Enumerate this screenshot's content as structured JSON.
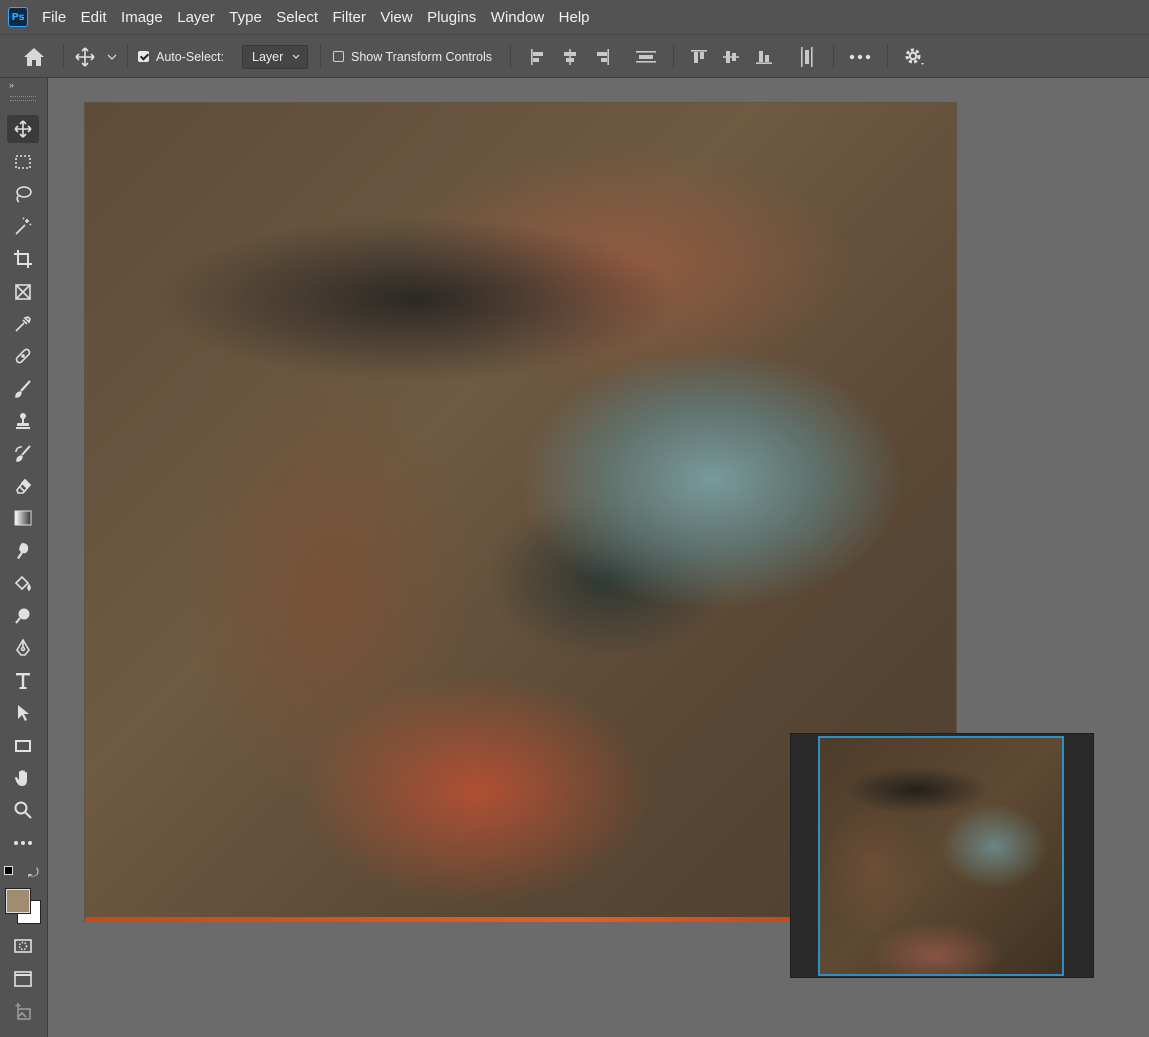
{
  "app": {
    "logo_text": "Ps"
  },
  "menu": [
    "File",
    "Edit",
    "Image",
    "Layer",
    "Type",
    "Select",
    "Filter",
    "View",
    "Plugins",
    "Window",
    "Help"
  ],
  "options": {
    "auto_select_label": "Auto-Select:",
    "auto_select_checked": true,
    "auto_select_target": "Layer",
    "show_transform_label": "Show Transform Controls",
    "show_transform_checked": false
  },
  "toolbar": {
    "tools": [
      {
        "name": "move-tool",
        "icon": "move-icon",
        "active": true
      },
      {
        "name": "rectangular-marquee-tool",
        "icon": "marquee-icon"
      },
      {
        "name": "lasso-tool",
        "icon": "lasso-icon"
      },
      {
        "name": "magic-wand-tool",
        "icon": "magic-wand-icon"
      },
      {
        "name": "crop-tool",
        "icon": "crop-icon"
      },
      {
        "name": "frame-tool",
        "icon": "frame-icon"
      },
      {
        "name": "eyedropper-tool",
        "icon": "eyedropper-icon"
      },
      {
        "name": "healing-brush-tool",
        "icon": "bandage-icon"
      },
      {
        "name": "brush-tool",
        "icon": "brush-icon"
      },
      {
        "name": "clone-stamp-tool",
        "icon": "stamp-icon"
      },
      {
        "name": "history-brush-tool",
        "icon": "history-brush-icon"
      },
      {
        "name": "eraser-tool",
        "icon": "eraser-icon"
      },
      {
        "name": "gradient-tool",
        "icon": "gradient-icon"
      },
      {
        "name": "smudge-tool",
        "icon": "smudge-icon"
      },
      {
        "name": "paint-bucket-tool",
        "icon": "bucket-icon"
      },
      {
        "name": "dodge-tool",
        "icon": "dodge-icon"
      },
      {
        "name": "pen-tool",
        "icon": "pen-icon"
      },
      {
        "name": "type-tool",
        "icon": "type-icon"
      },
      {
        "name": "path-selection-tool",
        "icon": "arrow-icon"
      },
      {
        "name": "rectangle-tool",
        "icon": "rectangle-icon"
      },
      {
        "name": "hand-tool",
        "icon": "hand-icon"
      },
      {
        "name": "zoom-tool",
        "icon": "zoom-icon"
      },
      {
        "name": "more-tools",
        "icon": "more-icon"
      }
    ],
    "foreground_color": "#a08c6e",
    "background_color": "#ffffff"
  }
}
